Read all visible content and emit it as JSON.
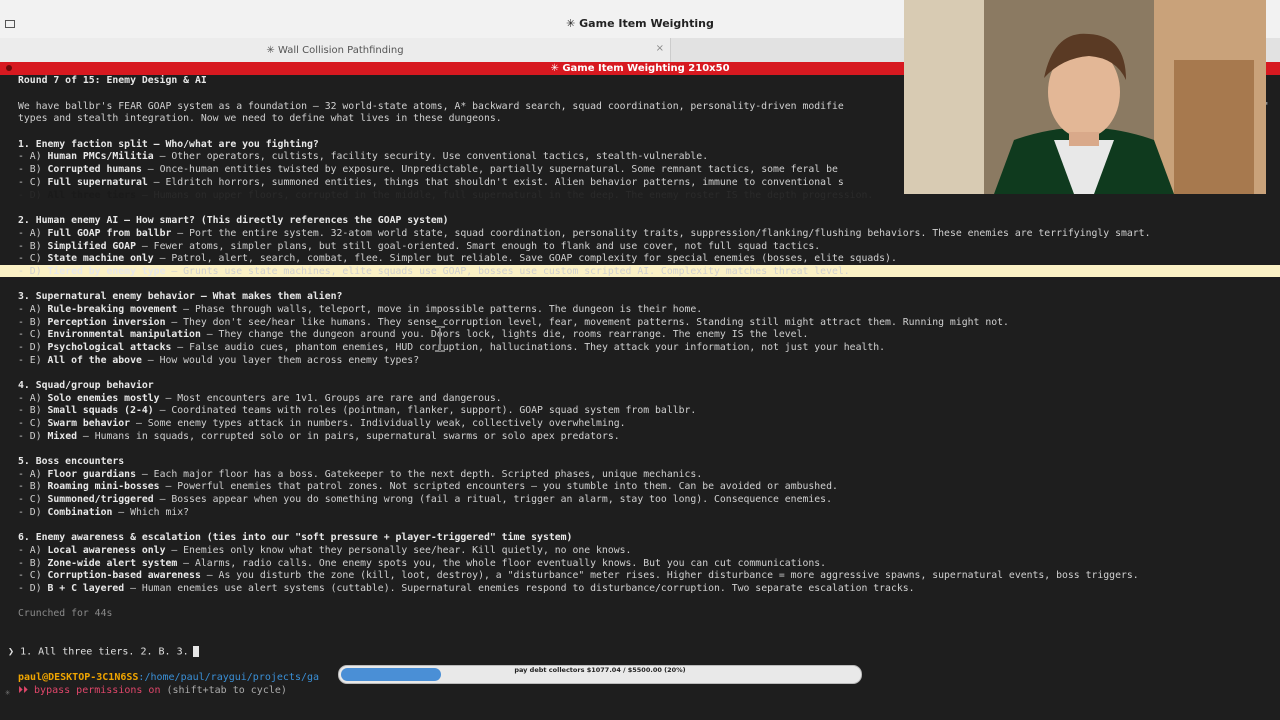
{
  "window": {
    "top_title": "✳ Game Item Weighting",
    "tabs": [
      {
        "label": "✳ Wall Collision Pathfinding"
      },
      {
        "label": ""
      }
    ],
    "tab_close_glyph": "×",
    "red_title": "✳ Game Item Weighting 210x50"
  },
  "content": {
    "round": "Round 7 of 15: Enemy Design & AI",
    "intro1": "We have ballbr's FEAR GOAP system as a foundation — 32 world-state atoms, A* backward search, squad coordination, personality-driven modifie",
    "intro1_tail": "e'",
    "intro2": "types and stealth integration. Now we need to define what lives in these dungeons.",
    "q1": {
      "title": "1. Enemy faction split — Who/what are you fighting?",
      "a": {
        "key": "Human PMCs/Militia",
        "text": " — Other operators, cultists, facility security. Use conventional tactics, stealth-vulnerable."
      },
      "b": {
        "key": "Corrupted humans",
        "text": " — Once-human entities twisted by exposure. Unpredictable, partially supernatural. Some remnant tactics, some feral be"
      },
      "c": {
        "key": "Full supernatural",
        "text": " — Eldritch horrors, summoned entities, things that shouldn't exist. Alien behavior patterns, immune to conventional s"
      },
      "d": {
        "key": "All three tiers",
        "text": " — Humans on upper floors, corrupted in the middle, full supernatural in the deep. The enemy roster IS the depth progression."
      }
    },
    "q2": {
      "title": "2. Human enemy AI — How smart? (This directly references the GOAP system)",
      "a": {
        "key": "Full GOAP from ballbr",
        "text": " — Port the entire system. 32-atom world state, squad coordination, personality traits, suppression/flanking/flushing behaviors. These enemies are terrifyingly smart."
      },
      "b": {
        "key": "Simplified GOAP",
        "text": " — Fewer atoms, simpler plans, but still goal-oriented. Smart enough to flank and use cover, not full squad tactics."
      },
      "c": {
        "key": "State machine only",
        "text": " — Patrol, alert, search, combat, flee. Simpler but reliable. Save GOAP complexity for special enemies (bosses, elite squads)."
      },
      "d": {
        "key": "Tiered by enemy type",
        "text": " — Grunts use state machines, elite squads use GOAP, bosses use custom scripted AI. Complexity matches threat level."
      }
    },
    "q3": {
      "title": "3. Supernatural enemy behavior — What makes them alien?",
      "a": {
        "key": "Rule-breaking movement",
        "text": " — Phase through walls, teleport, move in impossible patterns. The dungeon is their home."
      },
      "b": {
        "key": "Perception inversion",
        "text": " — They don't see/hear like humans. They sense corruption level, fear, movement patterns. Standing still might attract them. Running might not."
      },
      "c": {
        "key": "Environmental manipulation",
        "text": " — They change the dungeon around you. Doors lock, lights die, rooms rearrange. The enemy IS the level."
      },
      "d": {
        "key": "Psychological attacks",
        "text": " — False audio cues, phantom enemies, HUD corruption, hallucinations. They attack your information, not just your health."
      },
      "e": {
        "key": "All of the above",
        "text": " — How would you layer them across enemy types?"
      }
    },
    "q4": {
      "title": "4. Squad/group behavior",
      "a": {
        "key": "Solo enemies mostly",
        "text": " — Most encounters are 1v1. Groups are rare and dangerous."
      },
      "b": {
        "key": "Small squads (2-4)",
        "text": " — Coordinated teams with roles (pointman, flanker, support). GOAP squad system from ballbr."
      },
      "c": {
        "key": "Swarm behavior",
        "text": " — Some enemy types attack in numbers. Individually weak, collectively overwhelming."
      },
      "d": {
        "key": "Mixed",
        "text": " — Humans in squads, corrupted solo or in pairs, supernatural swarms or solo apex predators."
      }
    },
    "q5": {
      "title": "5. Boss encounters",
      "a": {
        "key": "Floor guardians",
        "text": " — Each major floor has a boss. Gatekeeper to the next depth. Scripted phases, unique mechanics."
      },
      "b": {
        "key": "Roaming mini-bosses",
        "text": " — Powerful enemies that patrol zones. Not scripted encounters — you stumble into them. Can be avoided or ambushed."
      },
      "c": {
        "key": "Summoned/triggered",
        "text": " — Bosses appear when you do something wrong (fail a ritual, trigger an alarm, stay too long). Consequence enemies."
      },
      "d": {
        "key": "Combination",
        "text": " — Which mix?"
      }
    },
    "q6": {
      "title": "6. Enemy awareness & escalation (ties into our \"soft pressure + player-triggered\" time system)",
      "a": {
        "key": "Local awareness only",
        "text": " — Enemies only know what they personally see/hear. Kill quietly, no one knows."
      },
      "b": {
        "key": "Zone-wide alert system",
        "text": " — Alarms, radio calls. One enemy spots you, the whole floor eventually knows. But you can cut communications."
      },
      "c": {
        "key": "Corruption-based awareness",
        "text": " — As you disturb the zone (kill, loot, destroy), a \"disturbance\" meter rises. Higher disturbance = more aggressive spawns, supernatural events, boss triggers."
      },
      "d": {
        "key": "B + C layered",
        "text": " — Human enemies use alert systems (cuttable). Supernatural enemies respond to disturbance/corruption. Two separate escalation tracks."
      }
    },
    "crunched": "Crunched for 44s"
  },
  "prompt": {
    "glyph": "❯",
    "input": "1. All three tiers. 2. B. 3."
  },
  "status": {
    "user": "paul@DESKTOP-3C1N6SS",
    "path": ":/home/paul/raygui/projects/ga",
    "perm_icon": "⏵⏵",
    "perm_on": "bypass permissions on",
    "perm_hint": " (shift+tab to cycle)"
  },
  "overlay": {
    "progress_label": "pay debt collectors $1077.04 / $5500.00 (20%)",
    "progress_fraction": 0.2
  },
  "colors": {
    "accent_red": "#d71920",
    "highlight": "#fbf1c5",
    "progress_fill": "#4a8fd6"
  }
}
